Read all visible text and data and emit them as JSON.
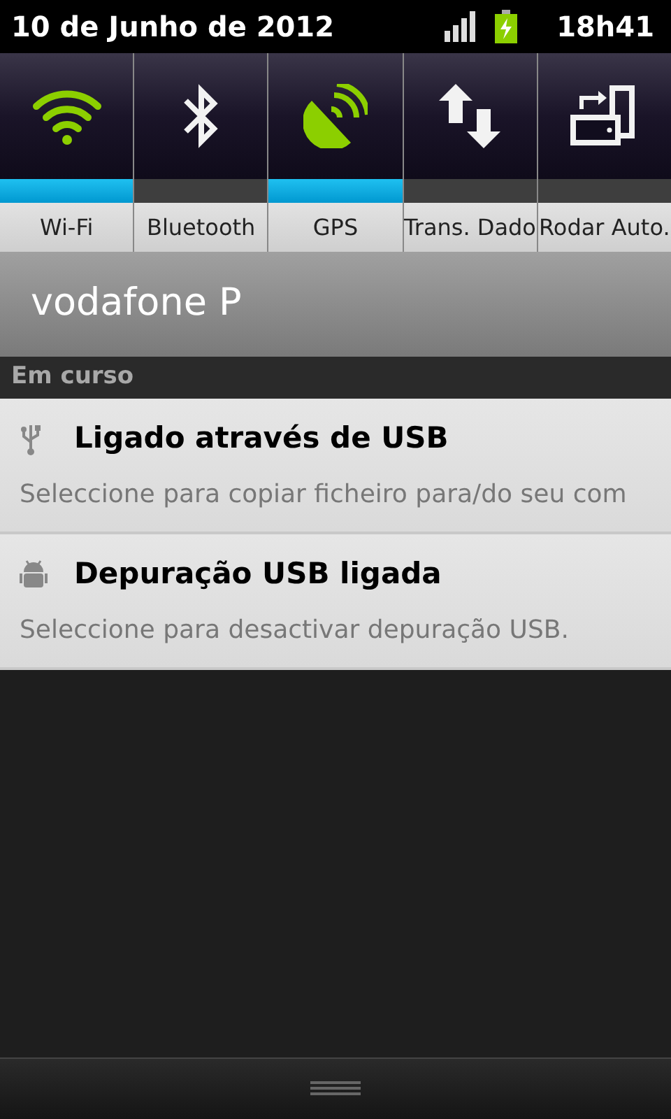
{
  "status_bar": {
    "date": "10 de Junho de 2012",
    "time": "18h41"
  },
  "toggles": [
    {
      "kind": "wifi",
      "label": "Wi-Fi",
      "on": true
    },
    {
      "kind": "bluetooth",
      "label": "Bluetooth",
      "on": false
    },
    {
      "kind": "gps",
      "label": "GPS",
      "on": true
    },
    {
      "kind": "data",
      "label": "Trans. Dado",
      "on": false
    },
    {
      "kind": "rotate",
      "label": "Rodar Auto.",
      "on": false
    }
  ],
  "carrier": "vodafone P",
  "section_header": "Em curso",
  "notifications": [
    {
      "kind": "usb",
      "title": "Ligado através de USB",
      "text": "Seleccione para copiar ficheiro para/do seu com"
    },
    {
      "kind": "android",
      "title": "Depuração USB ligada",
      "text": "Seleccione para desactivar depuração USB."
    }
  ]
}
